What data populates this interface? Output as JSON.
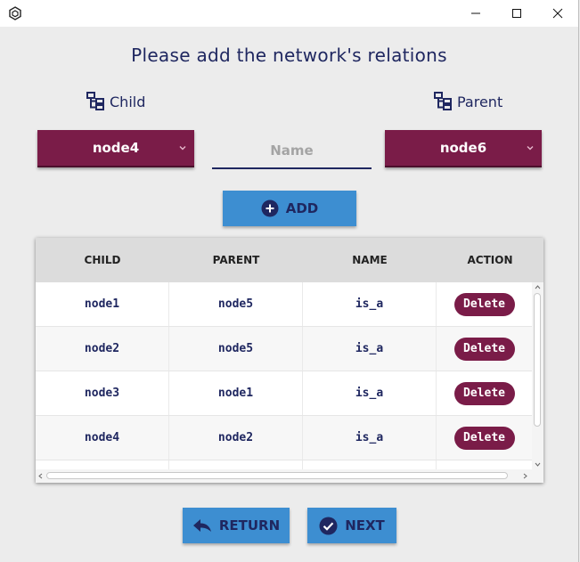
{
  "window": {
    "controls": {
      "minimize": "minimize-icon",
      "maximize": "maximize-icon",
      "close": "close-icon"
    }
  },
  "heading": "Please add the network's relations",
  "child": {
    "label": "Child",
    "selected": "node4"
  },
  "parent": {
    "label": "Parent",
    "selected": "node6"
  },
  "name_input": {
    "placeholder": "Name",
    "value": ""
  },
  "add_button": {
    "label": "ADD"
  },
  "table": {
    "columns": [
      "CHILD",
      "PARENT",
      "NAME",
      "ACTION"
    ],
    "rows": [
      {
        "child": "node1",
        "parent": "node5",
        "name": "is_a",
        "action": "Delete"
      },
      {
        "child": "node2",
        "parent": "node5",
        "name": "is_a",
        "action": "Delete"
      },
      {
        "child": "node3",
        "parent": "node1",
        "name": "is_a",
        "action": "Delete"
      },
      {
        "child": "node4",
        "parent": "node2",
        "name": "is_a",
        "action": "Delete"
      }
    ]
  },
  "return_button": {
    "label": "RETURN"
  },
  "next_button": {
    "label": "NEXT"
  },
  "colors": {
    "accent": "#7a1c48",
    "button_blue": "#3d8ed1",
    "text_dark": "#1f2760"
  }
}
